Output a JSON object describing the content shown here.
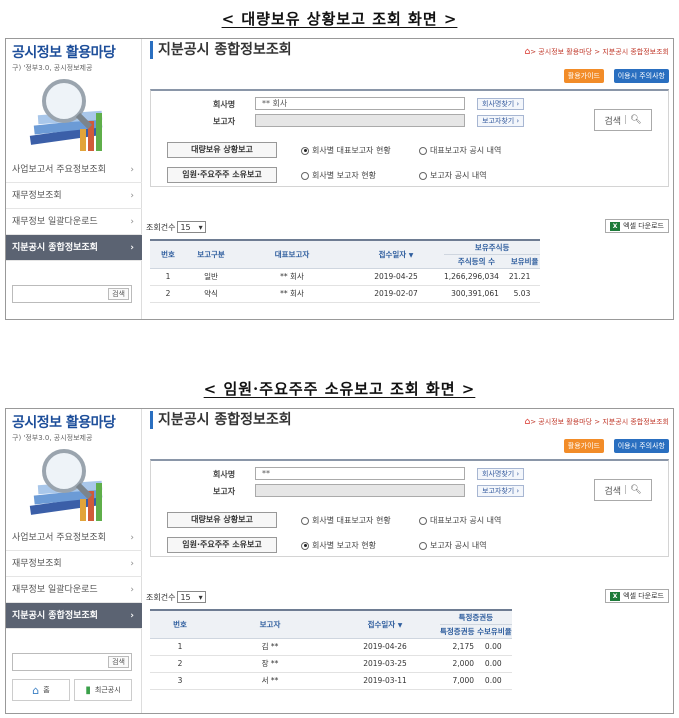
{
  "sections": [
    {
      "heading": "< 대량보유 상황보고 조회 화면 >",
      "brand_title": "공시정보 활용마당",
      "brand_sub": "구) '정부3.0, 공시정보제공",
      "nav": [
        {
          "label": "사업보고서 주요정보조회"
        },
        {
          "label": "재무정보조회"
        },
        {
          "label": "재무정보 일괄다운로드"
        },
        {
          "label": "지분공시 종합정보조회",
          "active": true
        }
      ],
      "side_search_btn": "검색",
      "page_title": "지분공시 종합정보조회",
      "breadcrumb": "> 공시정보 활용마당 > 지분공시 종합정보조회",
      "guide_btn": "활용가이드",
      "notice_btn": "이용시 주의사항",
      "company_label": "회사명",
      "company_value": "** 회사",
      "reporter_label": "보고자",
      "reporter_value": "",
      "find_company_btn": "회사명찾기 ›",
      "find_reporter_btn": "보고자찾기 ›",
      "search_btn": "검색",
      "tab1": "대량보유 상황보고",
      "tab2": "임원·주요주주 소유보고",
      "radio1a": "회사별 대표보고자 현황",
      "radio1b": "대표보고자 공시 내역",
      "radio2a": "회사별 보고자 현황",
      "radio2b": "보고자 공시 내역",
      "radio1a_on": true,
      "radio2a_on": false,
      "count_label": "조회건수",
      "count_value": "15",
      "excel_btn": "엑셀 다운로드",
      "table": {
        "group_header": "보유주식등",
        "headers": [
          "번호",
          "보고구분",
          "대표보고자",
          "접수일자",
          "주식등의 수",
          "보유비율"
        ],
        "rows": [
          [
            "1",
            "일반",
            "** 회사",
            "2019-04-25",
            "1,266,296,034",
            "21.21"
          ],
          [
            "2",
            "약식",
            "** 회사",
            "2019-02-07",
            "300,391,061",
            "5.03"
          ]
        ]
      }
    },
    {
      "heading": "< 임원·주요주주 소유보고 조회 화면 >",
      "brand_title": "공시정보 활용마당",
      "brand_sub": "구) '정부3.0, 공시정보제공",
      "nav": [
        {
          "label": "사업보고서 주요정보조회"
        },
        {
          "label": "재무정보조회"
        },
        {
          "label": "재무정보 일괄다운로드"
        },
        {
          "label": "지분공시 종합정보조회",
          "active": true
        }
      ],
      "side_search_btn": "검색",
      "quick_home": "홈",
      "quick_recent": "최근공시",
      "page_title": "지분공시 종합정보조회",
      "breadcrumb": "> 공시정보 활용마당 > 지분공시 종합정보조회",
      "guide_btn": "활용가이드",
      "notice_btn": "이용시 주의사항",
      "company_label": "회사명",
      "company_value": "**",
      "reporter_label": "보고자",
      "reporter_value": "",
      "find_company_btn": "회사명찾기 ›",
      "find_reporter_btn": "보고자찾기 ›",
      "search_btn": "검색",
      "tab1": "대량보유 상황보고",
      "tab2": "임원·주요주주 소유보고",
      "radio1a": "회사별 대표보고자 현황",
      "radio1b": "대표보고자 공시 내역",
      "radio2a": "회사별 보고자 현황",
      "radio2b": "보고자 공시 내역",
      "radio1a_on": false,
      "radio2a_on": true,
      "count_label": "조회건수",
      "count_value": "15",
      "excel_btn": "엑셀 다운로드",
      "table": {
        "group_header": "특정증권등",
        "headers": [
          "번호",
          "보고자",
          "접수일자",
          "특정증권등 수",
          "보유비율"
        ],
        "rows": [
          [
            "1",
            "김 **",
            "2019-04-26",
            "2,175",
            "0.00"
          ],
          [
            "2",
            "장 **",
            "2019-03-25",
            "2,000",
            "0.00"
          ],
          [
            "3",
            "서 **",
            "2019-03-11",
            "7,000",
            "0.00"
          ]
        ]
      }
    }
  ]
}
